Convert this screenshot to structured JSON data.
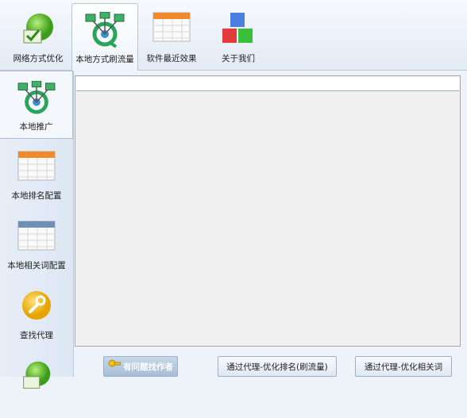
{
  "tabs": [
    {
      "label": "网络方式优化",
      "icon": "globe-check-icon"
    },
    {
      "label": "本地方式刷流量",
      "icon": "network-nodes-icon"
    },
    {
      "label": "软件最近效果",
      "icon": "calendar-icon"
    },
    {
      "label": "关于我们",
      "icon": "cubes-icon"
    }
  ],
  "sidebar": {
    "items": [
      {
        "label": "本地推广",
        "icon": "network-nodes-icon"
      },
      {
        "label": "本地排名配置",
        "icon": "calendar-icon"
      },
      {
        "label": "本地相关词配置",
        "icon": "calendar-icon"
      },
      {
        "label": "查找代理",
        "icon": "wrench-icon"
      },
      {
        "label": "",
        "icon": "globe-check-icon"
      }
    ]
  },
  "main": {
    "input_value": ""
  },
  "buttons": {
    "contact": "有问题找作者",
    "proxy_rank": "通过代理-优化排名(刷流量)",
    "proxy_related": "通过代理-优化相关词"
  }
}
